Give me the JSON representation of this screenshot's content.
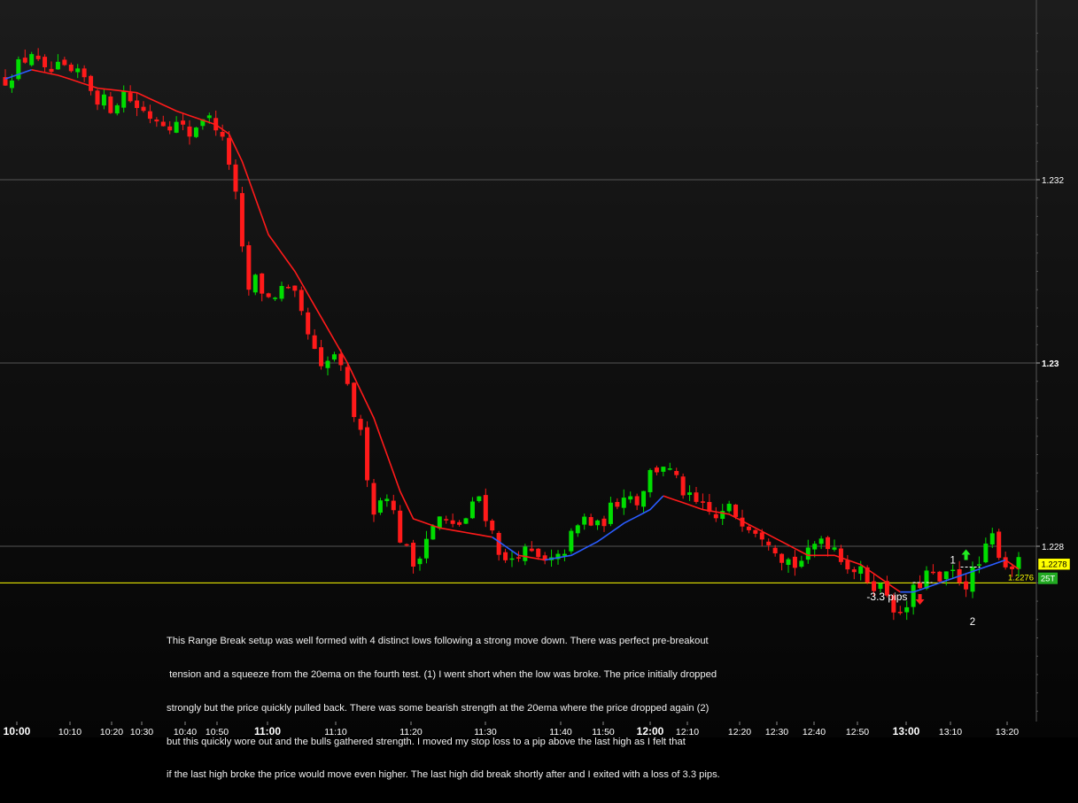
{
  "chart_data": {
    "type": "candlestick",
    "instrument_note": "",
    "ylim": [
      1.2245,
      1.2338
    ],
    "y_ticks": [
      {
        "value": 1.232,
        "label": "1.232"
      },
      {
        "value": 1.23,
        "label": "1.23"
      },
      {
        "value": 1.228,
        "label": "1.228"
      }
    ],
    "x_ticks": [
      {
        "label": "10:00",
        "bold": true
      },
      {
        "label": "10:10",
        "bold": false
      },
      {
        "label": "10:20",
        "bold": false
      },
      {
        "label": "10:30",
        "bold": false
      },
      {
        "label": "10:40",
        "bold": false
      },
      {
        "label": "10:50",
        "bold": false
      },
      {
        "label": "11:00",
        "bold": true
      },
      {
        "label": "11:10",
        "bold": false
      },
      {
        "label": "11:20",
        "bold": false
      },
      {
        "label": "11:30",
        "bold": false
      },
      {
        "label": "11:40",
        "bold": false
      },
      {
        "label": "11:50",
        "bold": false
      },
      {
        "label": "12:00",
        "bold": true
      },
      {
        "label": "12:10",
        "bold": false
      },
      {
        "label": "12:20",
        "bold": false
      },
      {
        "label": "12:30",
        "bold": false
      },
      {
        "label": "12:40",
        "bold": false
      },
      {
        "label": "12:50",
        "bold": false
      },
      {
        "label": "13:00",
        "bold": true
      },
      {
        "label": "13:10",
        "bold": false
      },
      {
        "label": "13:20",
        "bold": false
      }
    ],
    "close_path": [
      [
        0,
        1.2331
      ],
      [
        2,
        1.23324
      ],
      [
        4,
        1.2334
      ],
      [
        5,
        1.23325
      ],
      [
        6,
        1.23315
      ],
      [
        8,
        1.2332
      ],
      [
        10,
        1.23315
      ],
      [
        12,
        1.2331
      ],
      [
        14,
        1.2329
      ],
      [
        16,
        1.2328
      ],
      [
        18,
        1.23295
      ],
      [
        20,
        1.2328
      ],
      [
        22,
        1.2327
      ],
      [
        24,
        1.23265
      ],
      [
        26,
        1.2326
      ],
      [
        28,
        1.2325
      ],
      [
        30,
        1.2327
      ],
      [
        32,
        1.2326
      ],
      [
        34,
        1.2322
      ],
      [
        35,
        1.2318
      ],
      [
        36,
        1.2312
      ],
      [
        37,
        1.2308
      ],
      [
        38,
        1.2309
      ],
      [
        40,
        1.2307
      ],
      [
        42,
        1.2308
      ],
      [
        44,
        1.2307
      ],
      [
        46,
        1.2303
      ],
      [
        48,
        1.2299
      ],
      [
        50,
        1.2301
      ],
      [
        52,
        1.2297
      ],
      [
        54,
        1.2292
      ],
      [
        56,
        1.2284
      ],
      [
        58,
        1.2286
      ],
      [
        60,
        1.2281
      ],
      [
        62,
        1.2278
      ],
      [
        64,
        1.2281
      ],
      [
        66,
        1.2283
      ],
      [
        68,
        1.2282
      ],
      [
        70,
        1.2283
      ],
      [
        72,
        1.22855
      ],
      [
        74,
        1.22815
      ],
      [
        76,
        1.2278
      ],
      [
        78,
        1.22795
      ],
      [
        80,
        1.2279
      ],
      [
        82,
        1.2278
      ],
      [
        84,
        1.22785
      ],
      [
        86,
        1.2281
      ],
      [
        88,
        1.2283
      ],
      [
        90,
        1.2282
      ],
      [
        92,
        1.2284
      ],
      [
        94,
        1.2286
      ],
      [
        96,
        1.2285
      ],
      [
        98,
        1.2288
      ],
      [
        100,
        1.2289
      ],
      [
        102,
        1.2287
      ],
      [
        104,
        1.2285
      ],
      [
        106,
        1.2284
      ],
      [
        108,
        1.2283
      ],
      [
        110,
        1.2284
      ],
      [
        112,
        1.2283
      ],
      [
        114,
        1.2282
      ],
      [
        116,
        1.2281
      ],
      [
        118,
        1.2279
      ],
      [
        120,
        1.2278
      ],
      [
        122,
        1.2279
      ],
      [
        124,
        1.2281
      ],
      [
        126,
        1.228
      ],
      [
        128,
        1.2278
      ],
      [
        130,
        1.2277
      ],
      [
        132,
        1.2276
      ],
      [
        134,
        1.2275
      ],
      [
        136,
        1.2272
      ],
      [
        138,
        1.2275
      ],
      [
        140,
        1.2277
      ],
      [
        142,
        1.2276
      ],
      [
        144,
        1.2277
      ],
      [
        146,
        1.2276
      ],
      [
        148,
        1.2278
      ],
      [
        150,
        1.2281
      ],
      [
        152,
        1.2278
      ],
      [
        154,
        1.2278
      ]
    ],
    "ema_path": [
      [
        0,
        1.2331
      ],
      [
        4,
        1.2332
      ],
      [
        8,
        1.23314
      ],
      [
        14,
        1.233
      ],
      [
        20,
        1.23295
      ],
      [
        26,
        1.23275
      ],
      [
        32,
        1.2326
      ],
      [
        34,
        1.2325
      ],
      [
        36,
        1.2322
      ],
      [
        38,
        1.2318
      ],
      [
        40,
        1.2314
      ],
      [
        44,
        1.231
      ],
      [
        48,
        1.2305
      ],
      [
        52,
        1.23
      ],
      [
        56,
        1.2294
      ],
      [
        58,
        1.229
      ],
      [
        60,
        1.2286
      ],
      [
        62,
        1.2283
      ],
      [
        66,
        1.2282
      ],
      [
        70,
        1.22815
      ],
      [
        74,
        1.2281
      ],
      [
        78,
        1.2279
      ],
      [
        82,
        1.22785
      ],
      [
        86,
        1.2279
      ],
      [
        90,
        1.22805
      ],
      [
        94,
        1.22825
      ],
      [
        98,
        1.2284
      ],
      [
        100,
        1.22855
      ],
      [
        102,
        1.2285
      ],
      [
        106,
        1.2284
      ],
      [
        110,
        1.22835
      ],
      [
        114,
        1.2282
      ],
      [
        118,
        1.22805
      ],
      [
        122,
        1.2279
      ],
      [
        126,
        1.2279
      ],
      [
        130,
        1.2278
      ],
      [
        134,
        1.2276
      ],
      [
        136,
        1.2275
      ],
      [
        138,
        1.2275
      ],
      [
        142,
        1.2276
      ],
      [
        146,
        1.2277
      ],
      [
        150,
        1.2278
      ],
      [
        152,
        1.22785
      ],
      [
        154,
        1.22775
      ]
    ],
    "ema_rising_segments": [
      [
        0,
        4
      ],
      [
        74,
        78
      ],
      [
        82,
        100
      ],
      [
        136,
        152
      ]
    ],
    "horizontal_line": {
      "value": 1.2276,
      "label": "1.2276",
      "color": "#ffff00"
    },
    "last_price": {
      "value": 1.2278,
      "label": "1.2278"
    },
    "bar_type_label": "25T",
    "candle_count": 155,
    "annotations": [
      {
        "label": "1",
        "bar": 144,
        "value": 1.22781
      },
      {
        "label": "2",
        "bar": 147,
        "value": 1.22714
      },
      {
        "label": "-3.3 pips",
        "bar": 134,
        "value": 1.22741
      },
      {
        "label": "short-entry-arrow",
        "bar": 139,
        "value": 1.22742
      },
      {
        "label": "exit-arrow",
        "bar": 146,
        "value": 1.22785
      }
    ],
    "text_block": [
      "This Range Break setup was well formed with 4 distinct lows following a strong move down. There was perfect pre-breakout",
      " tension and a squeeze from the 20ema on the fourth test. (1) I went short when the low was broke. The price initially dropped",
      "strongly but the price quickly pulled back. There was some bearish strength at the 20ema where the price dropped again (2)",
      "but this quickly wore out and the bulls gathered strength. I moved my stop loss to a pip above the last high as I felt that",
      "if the last high broke the price would move even higher. The last high did break shortly after and I exited with a loss of 3.3 pips."
    ],
    "colors": {
      "up_candle": "#00dd00",
      "down_candle": "#ff1a1a",
      "ema_falling": "#ff1a1a",
      "ema_rising": "#2a5cff",
      "grid": "#6e6e6e",
      "axis_text": "#ffffff",
      "price_box": "#ffff00",
      "bar_type_box": "#22aa22"
    }
  }
}
